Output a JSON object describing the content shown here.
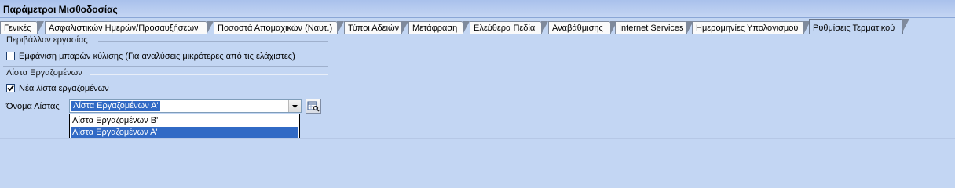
{
  "window": {
    "title": "Παράμετροι Μισθοδοσίας"
  },
  "tabs": [
    {
      "label": "Γενικές",
      "active": false
    },
    {
      "label": "Ασφαλιστικών Ημερών/Προσαυξήσεων",
      "active": false
    },
    {
      "label": "Ποσοστά Απομαχικών (Ναυτ.)",
      "active": false
    },
    {
      "label": "Τύποι Αδειών",
      "active": false
    },
    {
      "label": "Μετάφραση",
      "active": false
    },
    {
      "label": "Ελεύθερα Πεδία",
      "active": false
    },
    {
      "label": "Αναβάθμισης",
      "active": false
    },
    {
      "label": "Internet Services",
      "active": false
    },
    {
      "label": "Ημερομηνίες Υπολογισμού",
      "active": false
    },
    {
      "label": "Ρυθμίσεις Τερματικού",
      "active": true
    }
  ],
  "work_environment": {
    "group_label": "Περιβάλλον εργασίας",
    "scrollbar_checkbox": {
      "label": "Εμφάνιση μπαρών κύλισης (Για αναλύσεις μικρότερες από τις ελάχιστες)",
      "checked": false
    }
  },
  "employee_list": {
    "group_label": "Λίστα Εργαζομένων",
    "new_list_checkbox": {
      "label": "Νέα λίστα εργαζομένων",
      "checked": true
    },
    "list_name_label": "Όνομα Λίστας",
    "list_name_value": "Λίστα Εργαζομένων Α'",
    "dropdown_options": [
      {
        "label": "Λίστα Εργαζομένων Β'",
        "selected": false
      },
      {
        "label": "Λίστα Εργαζομένων Α'",
        "selected": true
      }
    ]
  }
}
